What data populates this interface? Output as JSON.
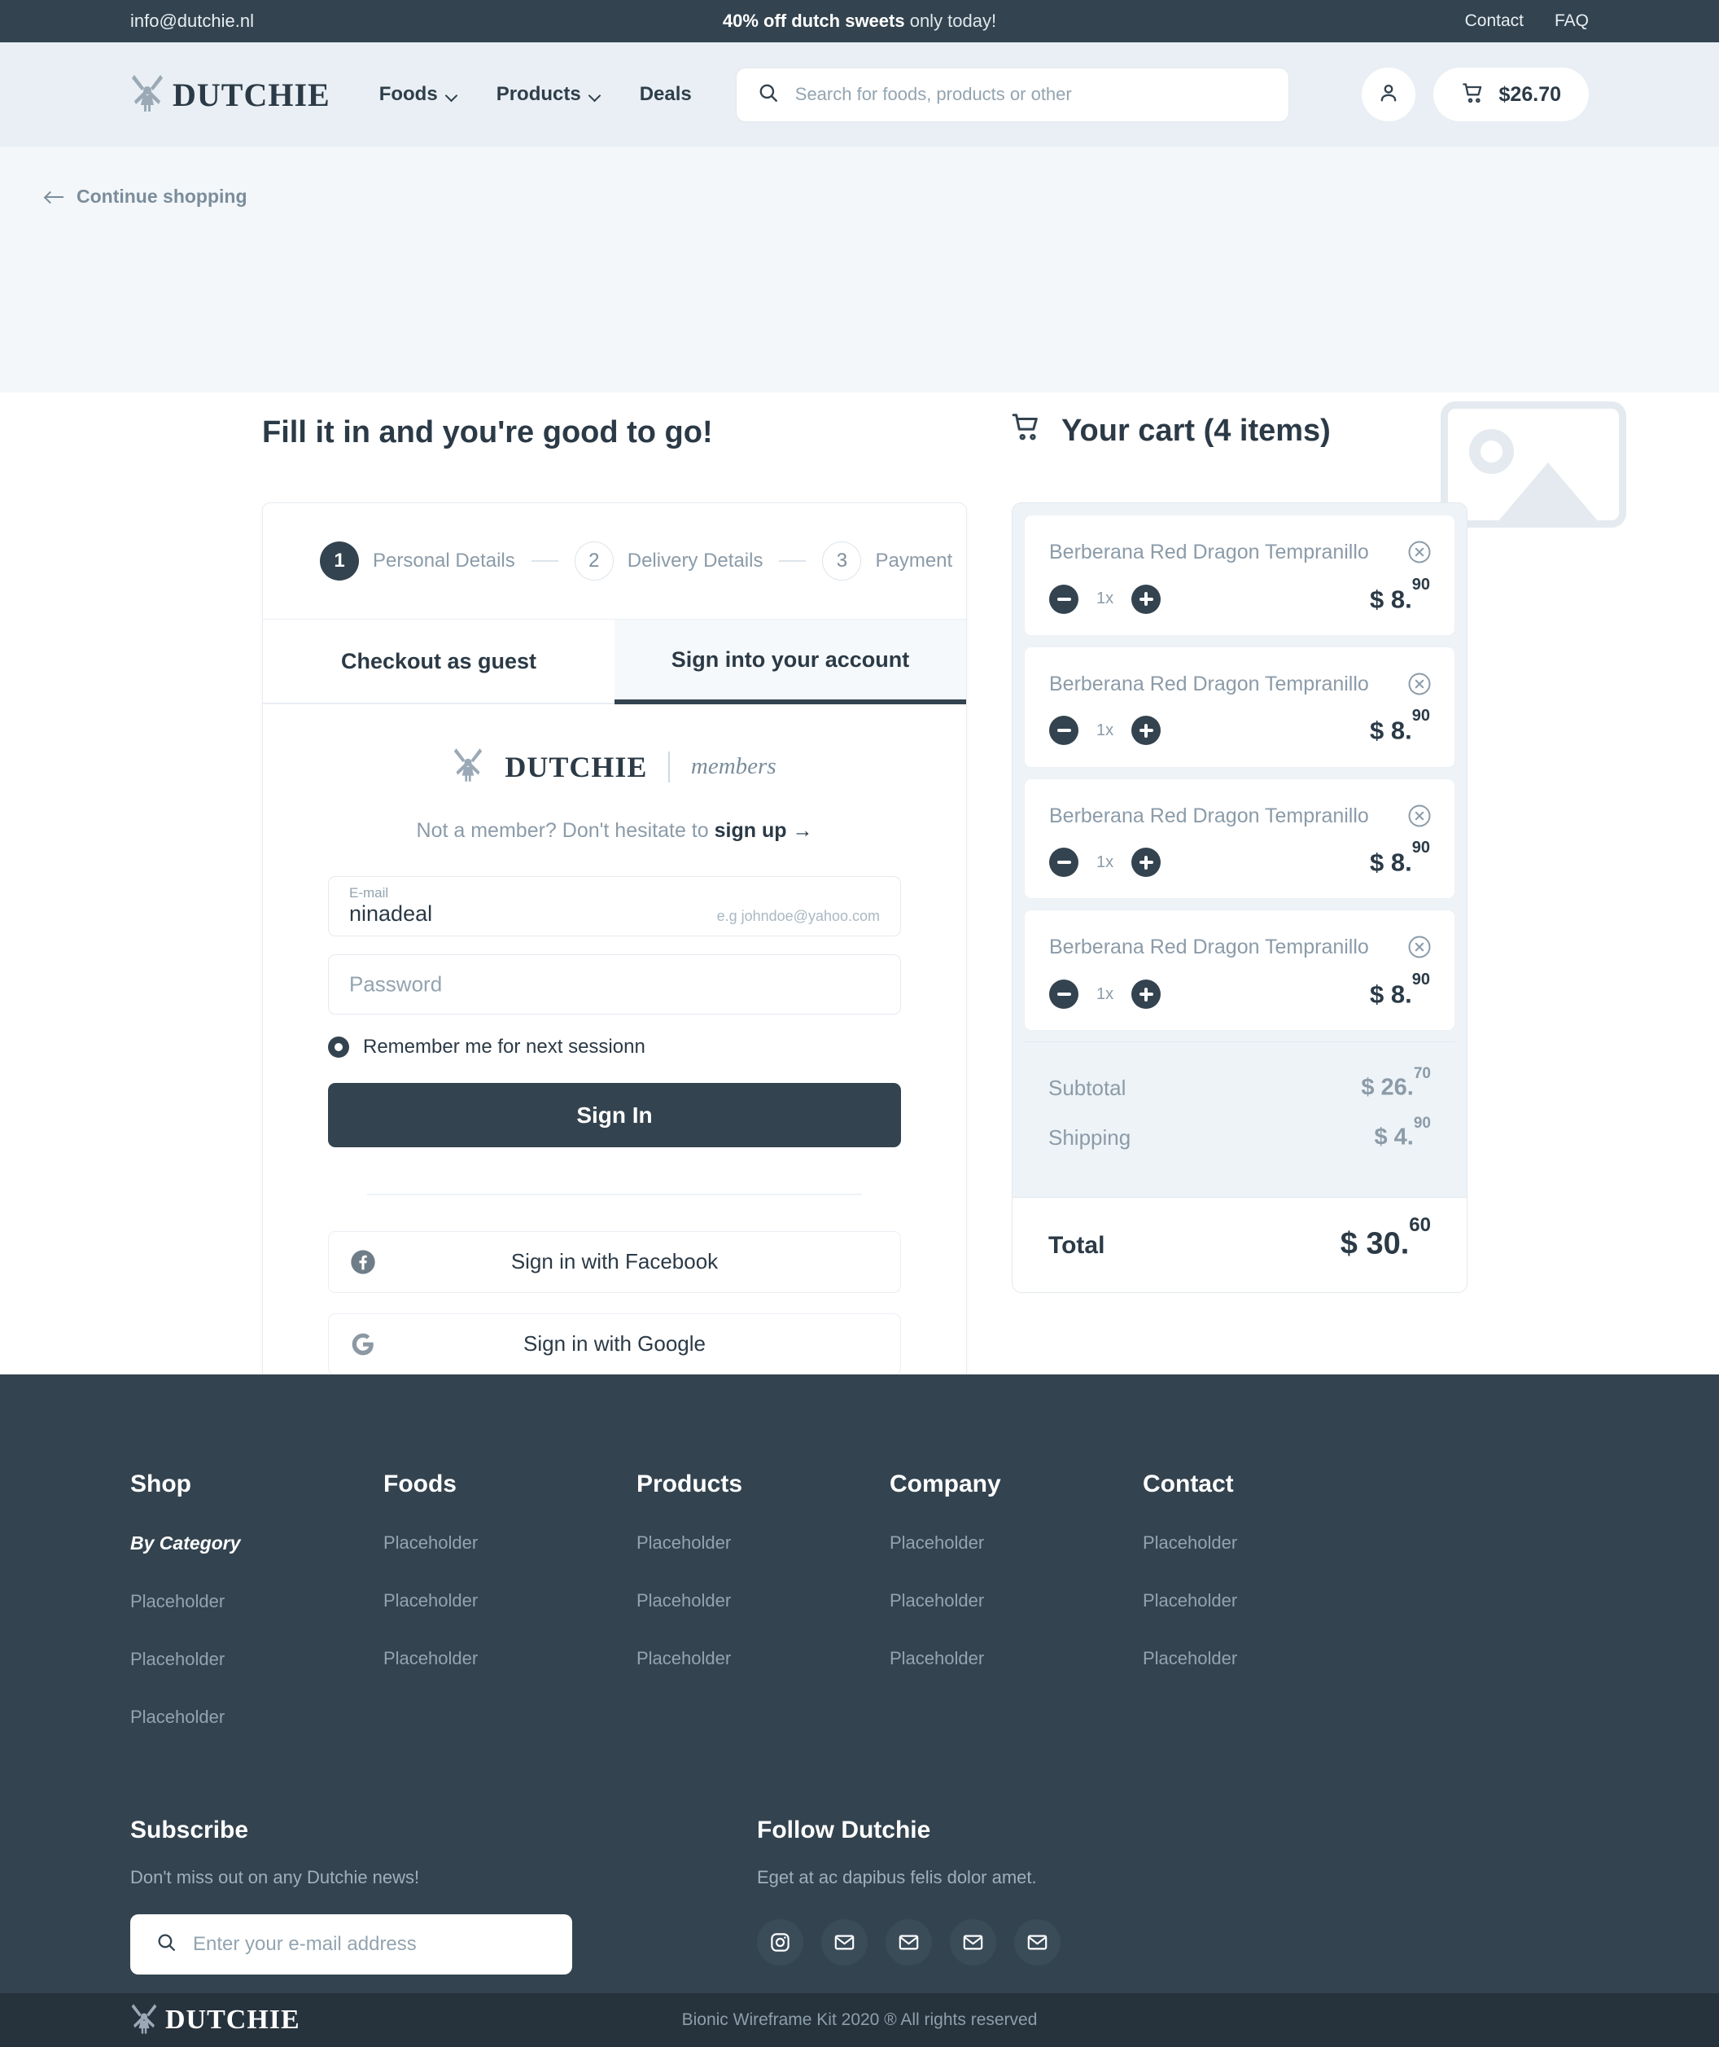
{
  "announce": {
    "email": "info@dutchie.nl",
    "promo_bold": "40% off dutch sweets",
    "promo_rest": " only today!",
    "links": [
      "Contact",
      "FAQ"
    ]
  },
  "header": {
    "brand": "DUTCHIE",
    "nav": [
      {
        "label": "Foods",
        "caret": true
      },
      {
        "label": "Products",
        "caret": true
      },
      {
        "label": "Deals",
        "caret": false
      }
    ],
    "search_placeholder": "Search for foods, products or other",
    "cart_amount": "$26.70"
  },
  "page": {
    "continue_label": "Continue shopping",
    "left_heading": "Fill it in and you're good to go!",
    "cart_heading": "Your cart (4 items)"
  },
  "checkout": {
    "steps": [
      {
        "num": "1",
        "label": "Personal Details",
        "active": true
      },
      {
        "num": "2",
        "label": "Delivery Details",
        "active": false
      },
      {
        "num": "3",
        "label": "Payment",
        "active": false
      }
    ],
    "tabs": [
      {
        "label": "Checkout as guest",
        "active": false
      },
      {
        "label": "Sign into your account",
        "active": true
      }
    ],
    "form_brand": "DUTCHIE",
    "form_brand_sub": "members",
    "signup_prefix": "Not a member? Don't hesitate to ",
    "signup_link": "sign up",
    "signup_arrow": "→",
    "email_label": "E-mail",
    "email_value": "ninadeal",
    "email_hint": "e.g  johndoe@yahoo.com",
    "password_placeholder": "Password",
    "remember_label": "Remember me for next sessionn",
    "signin_label": "Sign In",
    "facebook_label": "Sign in with Facebook",
    "google_label": "Sign in with Google"
  },
  "cart": {
    "items": [
      {
        "name": "Berberana Red Dragon Tempranillo",
        "qty": "1x",
        "price_main": "$ 8.",
        "price_cents": "90"
      },
      {
        "name": "Berberana Red Dragon Tempranillo",
        "qty": "1x",
        "price_main": "$ 8.",
        "price_cents": "90"
      },
      {
        "name": "Berberana Red Dragon Tempranillo",
        "qty": "1x",
        "price_main": "$ 8.",
        "price_cents": "90"
      },
      {
        "name": "Berberana Red Dragon Tempranillo",
        "qty": "1x",
        "price_main": "$ 8.",
        "price_cents": "90"
      }
    ],
    "subtotal_label": "Subtotal",
    "subtotal_main": "$ 26.",
    "subtotal_cents": "70",
    "shipping_label": "Shipping",
    "shipping_main": "$ 4.",
    "shipping_cents": "90",
    "total_label": "Total",
    "total_main": "$ 30.",
    "total_cents": "60"
  },
  "footer": {
    "columns": [
      {
        "title": "Shop",
        "bycat": "By Category",
        "links": [
          "Placeholder",
          "Placeholder",
          "Placeholder"
        ]
      },
      {
        "title": "Foods",
        "bycat": "",
        "links": [
          "Placeholder",
          "Placeholder",
          "Placeholder"
        ]
      },
      {
        "title": "Products",
        "bycat": "",
        "links": [
          "Placeholder",
          "Placeholder",
          "Placeholder"
        ]
      },
      {
        "title": "Company",
        "bycat": "",
        "links": [
          "Placeholder",
          "Placeholder",
          "Placeholder"
        ]
      },
      {
        "title": "Contact",
        "bycat": "",
        "links": [
          "Placeholder",
          "Placeholder",
          "Placeholder"
        ]
      }
    ],
    "subscribe_title": "Subscribe",
    "subscribe_text": "Don't miss out on any Dutchie news!",
    "subscribe_placeholder": "Enter your e-mail address",
    "follow_title": "Follow Dutchie",
    "follow_text": "Eget at ac dapibus felis dolor amet.",
    "socials": [
      "instagram-icon",
      "mail-icon",
      "mail-icon",
      "mail-icon",
      "mail-icon"
    ],
    "bottom_brand": "DUTCHIE",
    "copyright": "Bionic Wireframe Kit 2020 ® All rights reserved"
  },
  "colors": {
    "dark": "#33434f",
    "darker": "#26323c",
    "page_tint": "#f3f7fa",
    "header_tint": "#e9eff4",
    "muted": "#8b9ba8"
  }
}
